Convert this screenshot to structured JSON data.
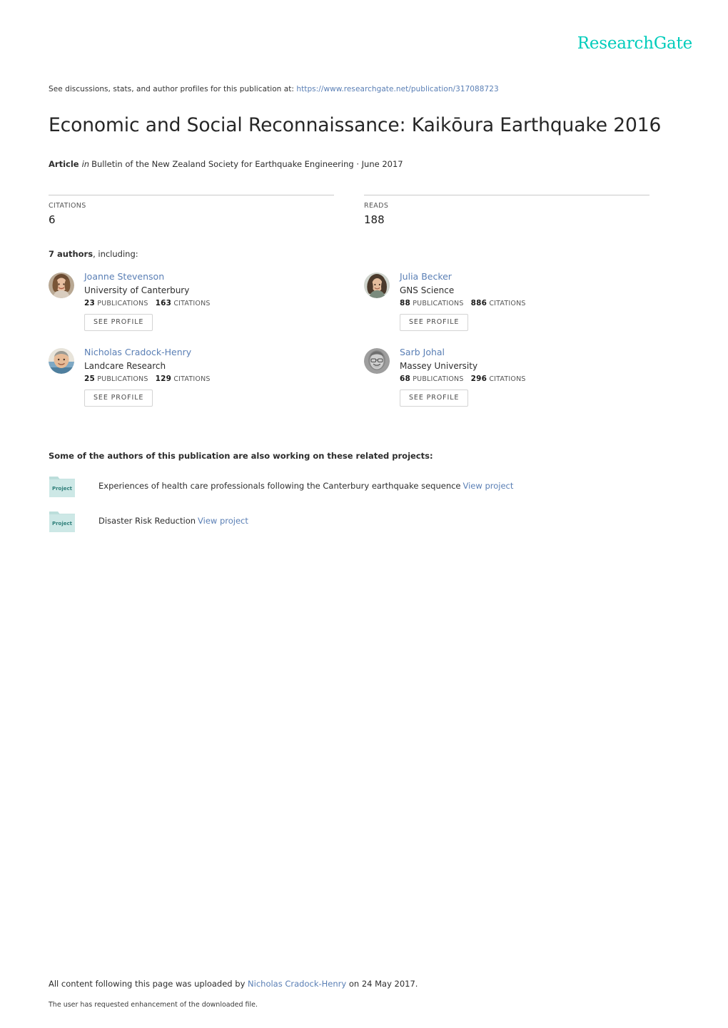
{
  "brand": {
    "logo_text": "ResearchGate",
    "logo_color": "#00ccbb"
  },
  "header": {
    "discussion_prefix": "See discussions, stats, and author profiles for this publication at:",
    "publication_url": "https://www.researchgate.net/publication/317088723",
    "title": "Economic and Social Reconnaissance: Kaikōura Earthquake 2016"
  },
  "article_line": {
    "type_label": "Article",
    "in_word": "in",
    "venue": "Bulletin of the New Zealand Society for Earthquake Engineering · June 2017"
  },
  "stats": [
    {
      "label": "CITATIONS",
      "value": "6"
    },
    {
      "label": "READS",
      "value": "188"
    }
  ],
  "authors_section": {
    "count_text": "7 authors",
    "including_text": ", including:",
    "see_profile_label": "SEE PROFILE",
    "publications_label": "PUBLICATIONS",
    "citations_label": "CITATIONS",
    "authors": [
      {
        "name": "Joanne Stevenson",
        "affiliation": "University of Canterbury",
        "publications": "23",
        "citations": "163",
        "avatar_icon": "avatar-photo-joanne-stevenson"
      },
      {
        "name": "Julia Becker",
        "affiliation": "GNS Science",
        "publications": "88",
        "citations": "886",
        "avatar_icon": "avatar-photo-julia-becker"
      },
      {
        "name": "Nicholas Cradock-Henry",
        "affiliation": "Landcare Research",
        "publications": "25",
        "citations": "129",
        "avatar_icon": "avatar-photo-nicholas-cradock-henry"
      },
      {
        "name": "Sarb Johal",
        "affiliation": "Massey University",
        "publications": "68",
        "citations": "296",
        "avatar_icon": "avatar-photo-sarb-johal"
      }
    ]
  },
  "projects_section": {
    "heading": "Some of the authors of this publication are also working on these related projects:",
    "icon_label": "Project",
    "view_link_label": "View project",
    "projects": [
      {
        "title": "Experiences of health care professionals following the Canterbury earthquake sequence"
      },
      {
        "title": "Disaster Risk Reduction"
      }
    ]
  },
  "footer": {
    "upload_prefix": "All content following this page was uploaded by",
    "uploader_name": "Nicholas Cradock-Henry",
    "upload_suffix": "on 24 May 2017.",
    "enhancement_note": "The user has requested enhancement of the downloaded file."
  }
}
